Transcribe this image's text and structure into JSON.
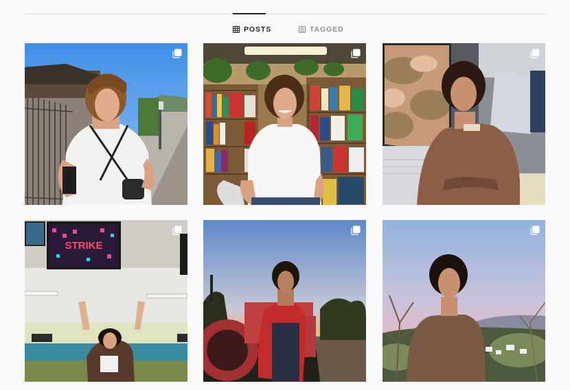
{
  "tabs": {
    "posts": {
      "label": "POSTS",
      "icon": "grid-icon",
      "active": true
    },
    "tagged": {
      "label": "TAGGED",
      "icon": "tagged-user-icon",
      "active": false
    }
  },
  "posts": [
    {
      "icon": "multiple-photos-icon",
      "scene": "sidewalk"
    },
    {
      "icon": "multiple-photos-icon",
      "scene": "bookstore"
    },
    {
      "icon": "multiple-photos-icon",
      "scene": "train"
    },
    {
      "icon": "multiple-photos-icon",
      "scene": "bowling-alley",
      "sign_text": "STRIKE"
    },
    {
      "icon": "multiple-photos-icon",
      "scene": "tractor-sunset"
    },
    {
      "icon": "multiple-photos-icon",
      "scene": "pink-sky-hillside"
    }
  ],
  "colors": {
    "active_tab": "#262626",
    "inactive_tab": "#8e8e8e",
    "divider": "#dbdbdb"
  }
}
